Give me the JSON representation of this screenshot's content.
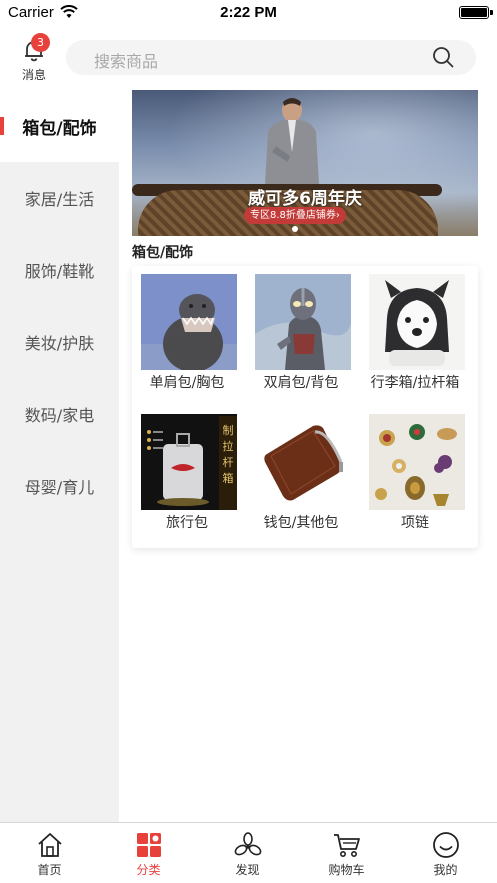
{
  "status_bar": {
    "carrier": "Carrier",
    "time": "2:22 PM"
  },
  "header": {
    "message_label": "消息",
    "message_badge": "3",
    "search_placeholder": "搜索商品"
  },
  "sidebar": {
    "items": [
      {
        "label": "箱包/配饰",
        "active": true
      },
      {
        "label": "家居/生活",
        "active": false
      },
      {
        "label": "服饰/鞋靴",
        "active": false
      },
      {
        "label": "美妆/护肤",
        "active": false
      },
      {
        "label": "数码/家电",
        "active": false
      },
      {
        "label": "母婴/育儿",
        "active": false
      }
    ]
  },
  "banner": {
    "title": "威可多6周年庆",
    "subtitle": "专区8.8折叠店铺券›"
  },
  "section_title": "箱包/配饰",
  "categories": [
    {
      "label": "单肩包/胸包",
      "icon": "monster-toy-image"
    },
    {
      "label": "双肩包/背包",
      "icon": "ultraman-toy-image"
    },
    {
      "label": "行李箱/拉杆箱",
      "icon": "husky-puppy-image"
    },
    {
      "label": "旅行包",
      "icon": "luggage-ad-image"
    },
    {
      "label": "钱包/其他包",
      "icon": "leather-wallet-image"
    },
    {
      "label": "项链",
      "icon": "brooches-image"
    }
  ],
  "luggage_ad_text": "制拉杆箱",
  "tabbar": {
    "tabs": [
      {
        "label": "首页",
        "icon": "home-icon",
        "active": false
      },
      {
        "label": "分类",
        "icon": "category-icon",
        "active": true
      },
      {
        "label": "发现",
        "icon": "discover-icon",
        "active": false
      },
      {
        "label": "购物车",
        "icon": "cart-icon",
        "active": false
      },
      {
        "label": "我的",
        "icon": "profile-icon",
        "active": false
      }
    ]
  },
  "colors": {
    "accent": "#e8413c",
    "sidebar_bg": "#f1f1f1"
  }
}
